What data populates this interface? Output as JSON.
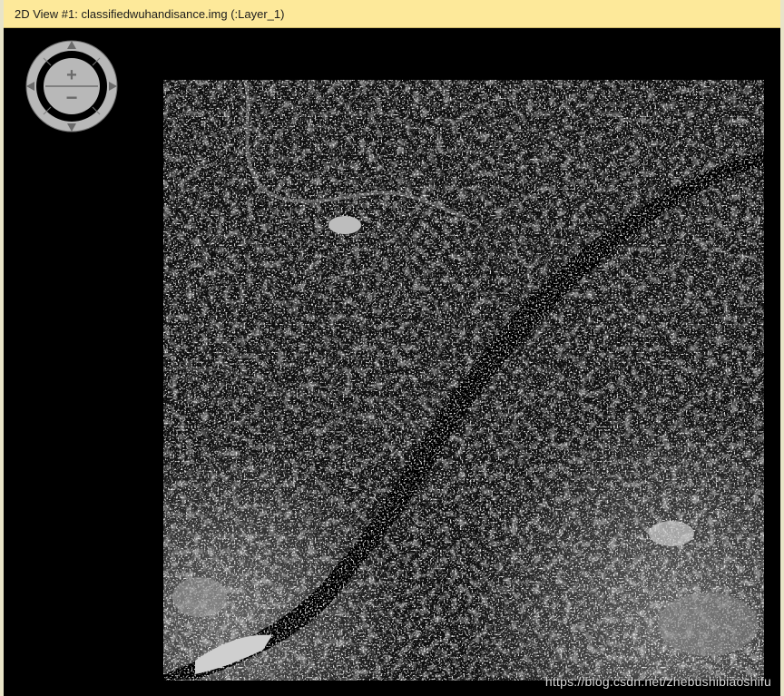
{
  "window": {
    "title": "2D View #1: classifiedwuhandisance.img (:Layer_1)"
  },
  "navigator": {
    "zoom_in_icon": "plus-icon",
    "zoom_out_icon": "minus-icon",
    "pan_icons": [
      "arrow-up-icon",
      "arrow-down-icon",
      "arrow-left-icon",
      "arrow-right-icon"
    ],
    "zoom_in_symbol": "+",
    "zoom_out_symbol": "−"
  },
  "raster": {
    "content": "grayscale classified raster image"
  },
  "watermark": {
    "text": "https://blog.csdn.net/zhebushibiaoshifu"
  },
  "colors": {
    "title_bar": "#fde99a",
    "canvas_background": "#000000",
    "navigator_ring": "#b8b8b8"
  }
}
